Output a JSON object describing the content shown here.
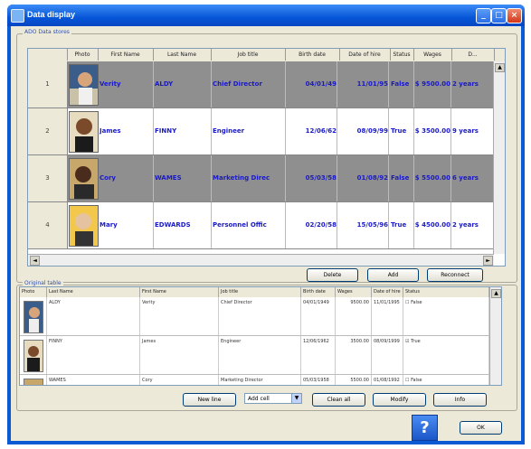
{
  "window": {
    "title": "Data display"
  },
  "ado_grid": {
    "group_label": "ADO Data stores",
    "columns": [
      "Photo",
      "First Name",
      "Last Name",
      "Job title",
      "Birth date",
      "Date of hire",
      "Status",
      "Wages",
      "D..."
    ],
    "rows": [
      {
        "num": "1",
        "first": "Verity",
        "last": "ALDY",
        "job": "Chief Director",
        "birth": "04/01/49",
        "hire": "11/01/95",
        "status": "False",
        "wages": "$ 9500.00",
        "duration": "2 years"
      },
      {
        "num": "2",
        "first": "James",
        "last": "FINNY",
        "job": "Engineer",
        "birth": "12/06/62",
        "hire": "08/09/99",
        "status": "True",
        "wages": "$ 3500.00",
        "duration": "9 years"
      },
      {
        "num": "3",
        "first": "Cory",
        "last": "WAMES",
        "job": "Marketing Direc",
        "birth": "05/03/58",
        "hire": "01/08/92",
        "status": "False",
        "wages": "$ 5500.00",
        "duration": "6 years"
      },
      {
        "num": "4",
        "first": "Mary",
        "last": "EDWARDS",
        "job": "Personnel Offic",
        "birth": "02/20/58",
        "hire": "15/05/96",
        "status": "True",
        "wages": "$ 4500.00",
        "duration": "2 years"
      }
    ],
    "buttons": {
      "delete": "Delete",
      "add": "Add",
      "reconnect": "Reconnect"
    }
  },
  "original_table": {
    "group_label": "Original table",
    "columns": [
      "Photo",
      "Last Name",
      "First Name",
      "Job title",
      "Birth date",
      "Wages",
      "Date of hire",
      "Status"
    ],
    "rows": [
      {
        "last": "ALDY",
        "first": "Verity",
        "job": "Chief Director",
        "birth": "04/01/1949",
        "wages": "9500.00",
        "hire": "11/01/1995",
        "status": "False"
      },
      {
        "last": "FINNY",
        "first": "James",
        "job": "Engineer",
        "birth": "12/06/1962",
        "wages": "3500.00",
        "hire": "08/09/1999",
        "status": "True"
      },
      {
        "last": "WAMES",
        "first": "Cory",
        "job": "Marketing Director",
        "birth": "05/03/1958",
        "wages": "5500.00",
        "hire": "01/08/1992",
        "status": "False"
      }
    ],
    "controls": {
      "new_line": "New line",
      "combo_value": "Add cell",
      "clean": "Clean all",
      "modify": "Modify",
      "info": "Info"
    }
  },
  "footer": {
    "help": "?",
    "ok": "OK"
  }
}
